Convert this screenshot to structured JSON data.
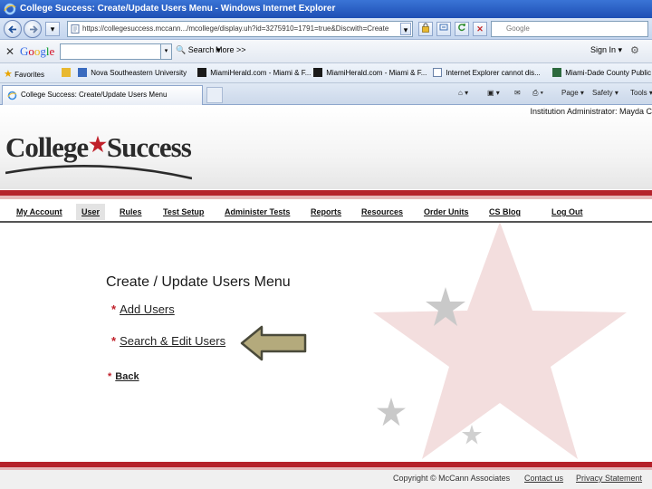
{
  "window": {
    "title": "College Success: Create/Update Users Menu - Windows Internet Explorer"
  },
  "addressbar": {
    "url": "https://collegesuccess.mccann.../mcollege/display.uh?id=3275910=1791=true&Discwith=Create",
    "search_placeholder": "Google"
  },
  "google_toolbar": {
    "logo": [
      "G",
      "o",
      "o",
      "g",
      "l",
      "e"
    ],
    "search_label": "Search",
    "more_label": "More >>",
    "signin_label": "Sign In"
  },
  "favorites": {
    "label": "Favorites",
    "items": [
      "Nova Southeastern University",
      "MiamiHerald.com - Miami & F...",
      "MiamiHerald.com - Miami & F...",
      "Internet Explorer cannot dis...",
      "Miami-Dade County Public S..."
    ]
  },
  "tab": {
    "label": "College Success: Create/Update Users Menu"
  },
  "commandbar": {
    "page_label": "Page",
    "safety_label": "Safety",
    "tools_label": "Tools"
  },
  "page": {
    "institution_admin": "Institution Administrator: Mayda C",
    "logo_left": "College",
    "logo_right": "Success",
    "nav": [
      "My Account",
      "User",
      "Rules",
      "Test Setup",
      "Administer Tests",
      "Reports",
      "Resources",
      "Order Units",
      "CS Blog",
      "Log Out"
    ],
    "active_nav": "User",
    "menu_title": "Create / Update Users Menu",
    "links": {
      "add_users": "Add Users",
      "search_edit_users": "Search & Edit Users",
      "back": "Back"
    },
    "bullet": "*",
    "footer": {
      "copyright": "Copyright © McCann Associates",
      "contact": "Contact us",
      "privacy": "Privacy Statement"
    }
  },
  "colors": {
    "brand_red": "#b5222b",
    "title_bar": "#2a5fc4",
    "arrow_fill": "#b4aa7c"
  }
}
